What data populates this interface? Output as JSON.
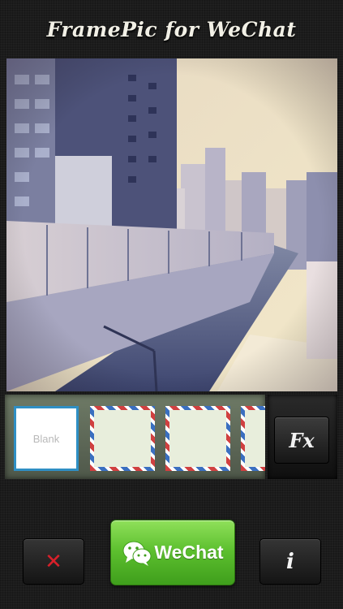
{
  "app": {
    "title": "FramePic for WeChat"
  },
  "frames": {
    "items": [
      {
        "label": "Blank",
        "selected": true
      },
      {
        "label": "",
        "style": "airmail"
      },
      {
        "label": "",
        "style": "airmail"
      },
      {
        "label": "",
        "style": "airmail"
      }
    ]
  },
  "toolbar": {
    "fx_label": "Fx",
    "close_label": "✕",
    "wechat_label": "WeChat",
    "info_label": "i"
  },
  "icons": {
    "close": "close-icon",
    "wechat": "wechat-icon",
    "info": "info-icon"
  },
  "colors": {
    "accent_blue": "#2f8fc4",
    "close_red": "#d8202a",
    "wechat_green": "#5cbf2e"
  }
}
